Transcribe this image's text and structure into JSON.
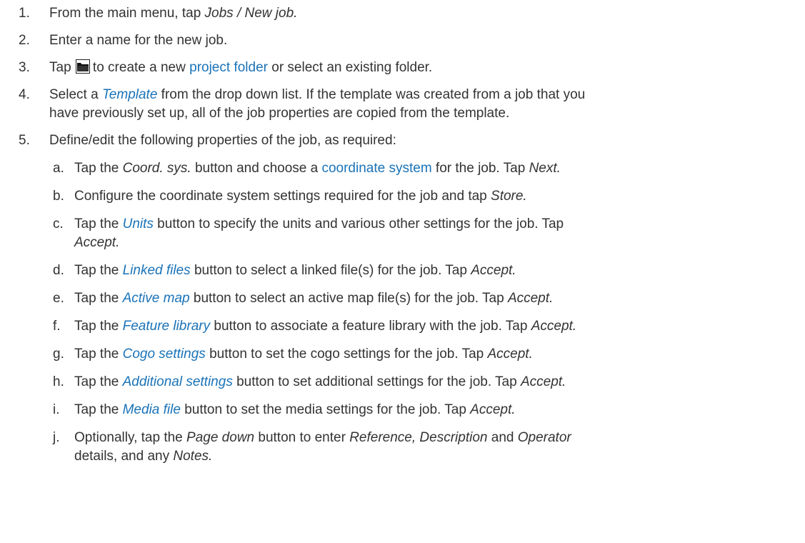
{
  "steps": [
    {
      "num": "1.",
      "t1": "From the main menu, tap ",
      "i1": "Jobs / New job."
    },
    {
      "num": "2.",
      "t1": "Enter a name for the new job."
    },
    {
      "num": "3.",
      "t1": "Tap ",
      "icon": "folder-icon",
      "t2": "to create a new ",
      "link": "project folder",
      "t3": " or select an existing folder."
    },
    {
      "num": "4.",
      "t1": "Select a ",
      "link": "Template",
      "t2": " from the drop down list. If the template was created from a job that you",
      "line2": "have previously set up, all of the job properties are copied from the template."
    },
    {
      "num": "5.",
      "t1": "Define/edit the following properties of the job, as required:"
    }
  ],
  "substeps": [
    {
      "letter": "a.",
      "t1": "Tap the ",
      "i1": "Coord. sys.",
      "t2": " button and choose a ",
      "link": "coordinate system",
      "t3": " for the job. Tap ",
      "i2": "Next."
    },
    {
      "letter": "b.",
      "t1": "Configure the coordinate system settings required for the job and tap ",
      "i1": "Store."
    },
    {
      "letter": "c.",
      "t1": "Tap the ",
      "link": "Units",
      "t2": " button to specify the units and various other settings for the job. Tap",
      "i2": "Accept."
    },
    {
      "letter": "d.",
      "t1": "Tap the ",
      "link": "Linked files",
      "t2": " button to select a linked file(s) for the job. Tap ",
      "i1": "Accept."
    },
    {
      "letter": "e.",
      "t1": "Tap the ",
      "link": "Active map",
      "t2": " button to select an active map file(s) for the job. Tap ",
      "i1": "Accept."
    },
    {
      "letter": "f.",
      "t1": "Tap the ",
      "link": "Feature library",
      "t2": " button to associate a feature library with the job. Tap ",
      "i1": "Accept."
    },
    {
      "letter": "g.",
      "t1": "Tap the ",
      "link": "Cogo settings",
      "t2": " button to set the cogo settings for the job. Tap ",
      "i1": "Accept."
    },
    {
      "letter": "h.",
      "t1": "Tap the ",
      "link": "Additional settings",
      "t2": " button to set additional settings for the job. Tap ",
      "i1": "Accept."
    },
    {
      "letter": "i.",
      "t1": "Tap the ",
      "link": "Media file",
      "t2": " button to set the media settings for the job. Tap ",
      "i1": "Accept."
    },
    {
      "letter": "j.",
      "t1": "Optionally, tap the ",
      "i1": "Page down",
      "t2": " button to enter ",
      "i2": "Reference, Description",
      "t3": " and ",
      "i3": "Operator",
      "line2a": "details, and any ",
      "line2b": "Notes."
    }
  ],
  "colors": {
    "text": "#333333",
    "link": "#1a73b8"
  }
}
